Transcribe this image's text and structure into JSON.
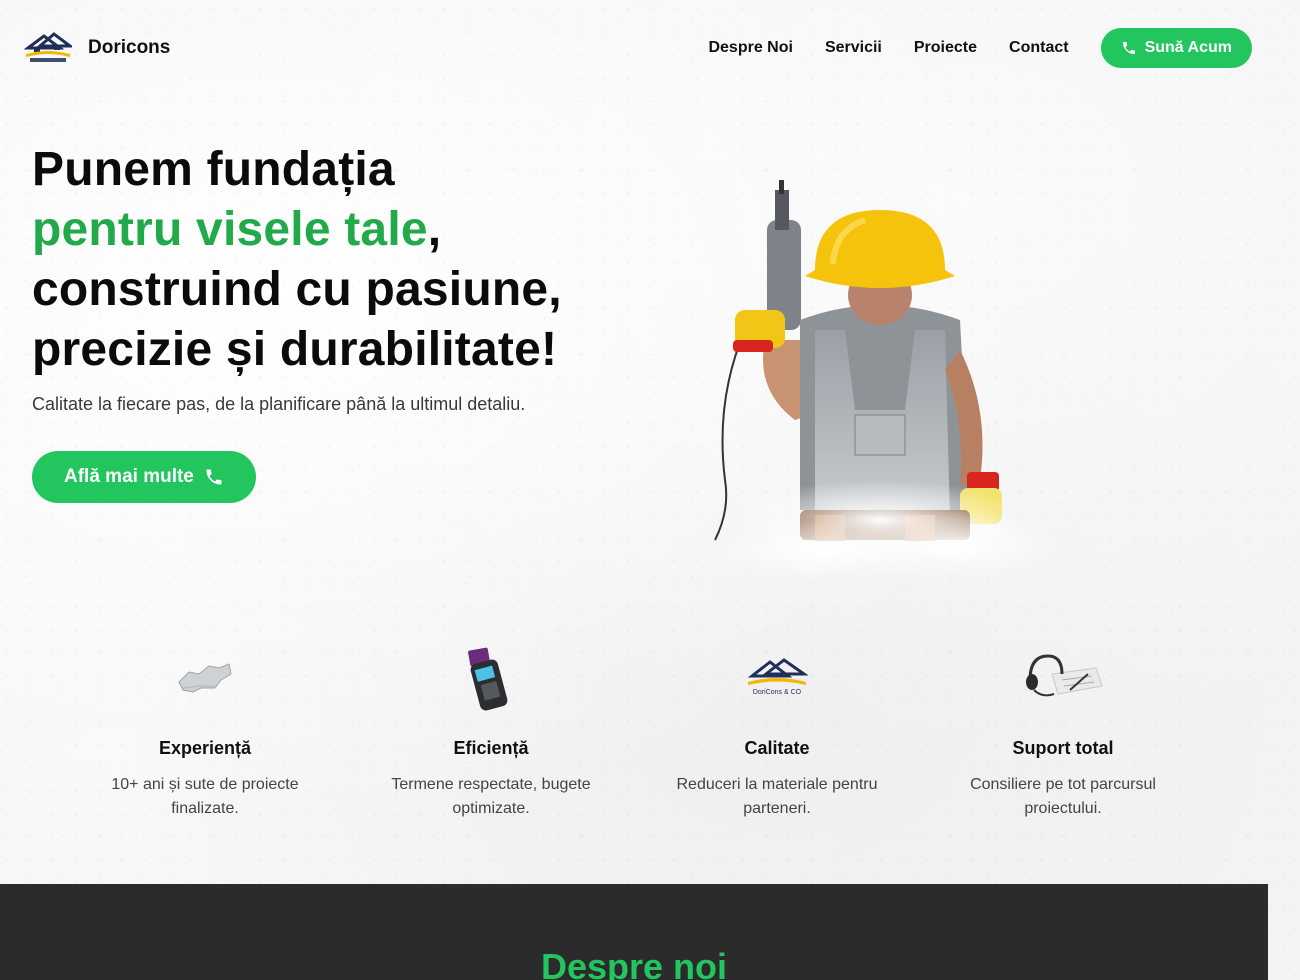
{
  "header": {
    "brand": "Doricons",
    "logo_text": "DoriCons & CO",
    "nav": [
      "Despre Noi",
      "Servicii",
      "Proiecte",
      "Contact"
    ],
    "call_button": "Sună Acum"
  },
  "hero": {
    "title_line1": "Punem fundația",
    "title_green": "pentru visele tale",
    "title_comma": ",",
    "title_line3": "construind cu pasiune,",
    "title_line4": "precizie și durabilitate!",
    "subtitle": "Calitate la fiecare pas, de la planificare până la ultimul detaliu.",
    "cta": "Află mai multe"
  },
  "features": [
    {
      "icon": "map-icon",
      "title": "Experiență",
      "text": "10+ ani și sute de proiecte finalizate."
    },
    {
      "icon": "card-terminal-icon",
      "title": "Eficiență",
      "text": "Termene respectate, bugete optimizate."
    },
    {
      "icon": "logo-house-icon",
      "title": "Calitate",
      "text": "Reduceri la materiale pentru parteneri."
    },
    {
      "icon": "headset-icon",
      "title": "Suport total",
      "text": "Consiliere pe tot parcursul proiectului."
    }
  ],
  "about": {
    "title": "Despre noi"
  },
  "colors": {
    "accent": "#22c55e",
    "accent_text": "#22a94a",
    "dark_band": "#2b2b2b"
  }
}
